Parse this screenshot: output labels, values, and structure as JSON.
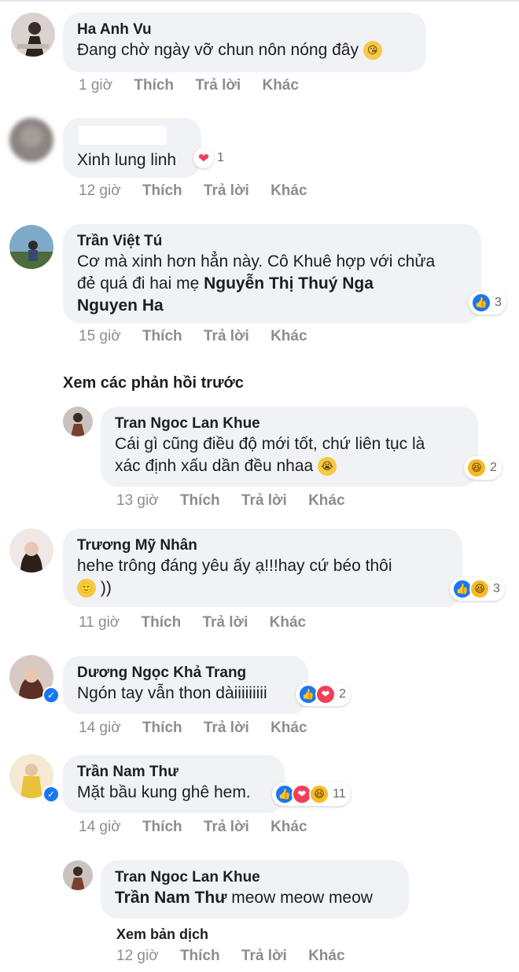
{
  "comments": [
    {
      "author": "Ha Anh Vu",
      "text": "Đang chờ ngày vỡ chun nôn nóng đây",
      "emoji_icon": "kiss-face-emoji",
      "time": "1 giờ"
    },
    {
      "author": "",
      "text": "Xinh lung linh",
      "reaction_count": "1",
      "reaction_icons": [
        "heart-icon"
      ],
      "time": "12 giờ"
    },
    {
      "author": "Trần Việt Tú",
      "text_line1": "Cơ mà xinh hơn hẳn này. Cô Khuê hợp với chửa",
      "text_line2": "đẻ quá đi hai mẹ ",
      "mention1": "Nguyễn Thị Thuý Nga",
      "mention2": "Nguyen Ha",
      "reaction_count": "3",
      "reaction_icons": [
        "like-icon"
      ],
      "time": "15 giờ"
    }
  ],
  "view_previous_replies": "Xem các phản hồi trước",
  "replies": [
    {
      "author": "Tran Ngoc Lan Khue",
      "text_line1": "Cái gì cũng điều độ mới tốt, chứ liên tục là",
      "text_line2": "xác định xấu dần đều nhaa",
      "emoji_icon": "crying-face-emoji",
      "reaction_count": "2",
      "reaction_icons": [
        "haha-icon"
      ],
      "time": "13 giờ"
    }
  ],
  "comments2": [
    {
      "author": "Trương Mỹ Nhân",
      "text_line1": "hehe trông đáng yêu ấy ạ!!!hay cứ béo thôi",
      "text_line2_suffix": "))",
      "emoji_icon": "smile-face-emoji",
      "reaction_count": "3",
      "reaction_icons": [
        "like-icon",
        "haha-icon"
      ],
      "time": "11 giờ"
    },
    {
      "author": "Dương Ngọc Khả Trang",
      "text": "Ngón tay vẫn thon dàiiiiiiiii",
      "reaction_count": "2",
      "reaction_icons": [
        "like-icon",
        "love-icon"
      ],
      "time": "14 giờ"
    },
    {
      "author": "Trần Nam Thư",
      "text": "Mặt bầu kung ghê hem.",
      "reaction_count": "11",
      "reaction_icons": [
        "like-icon",
        "love-icon",
        "haha-icon"
      ],
      "time": "14 giờ"
    }
  ],
  "reply2": {
    "author": "Tran Ngoc Lan Khue",
    "mention": "Trần Nam Thư",
    "text": " meow meow meow",
    "see_translation": "Xem bản dịch",
    "time": "12 giờ"
  },
  "actions": {
    "like": "Thích",
    "reply": "Trả lời",
    "more": "Khác"
  },
  "colors": {
    "bubble": "#f0f2f5",
    "meta": "#8a8d91",
    "like": "#1877f2",
    "love": "#f33e58",
    "haha": "#f7b928"
  }
}
